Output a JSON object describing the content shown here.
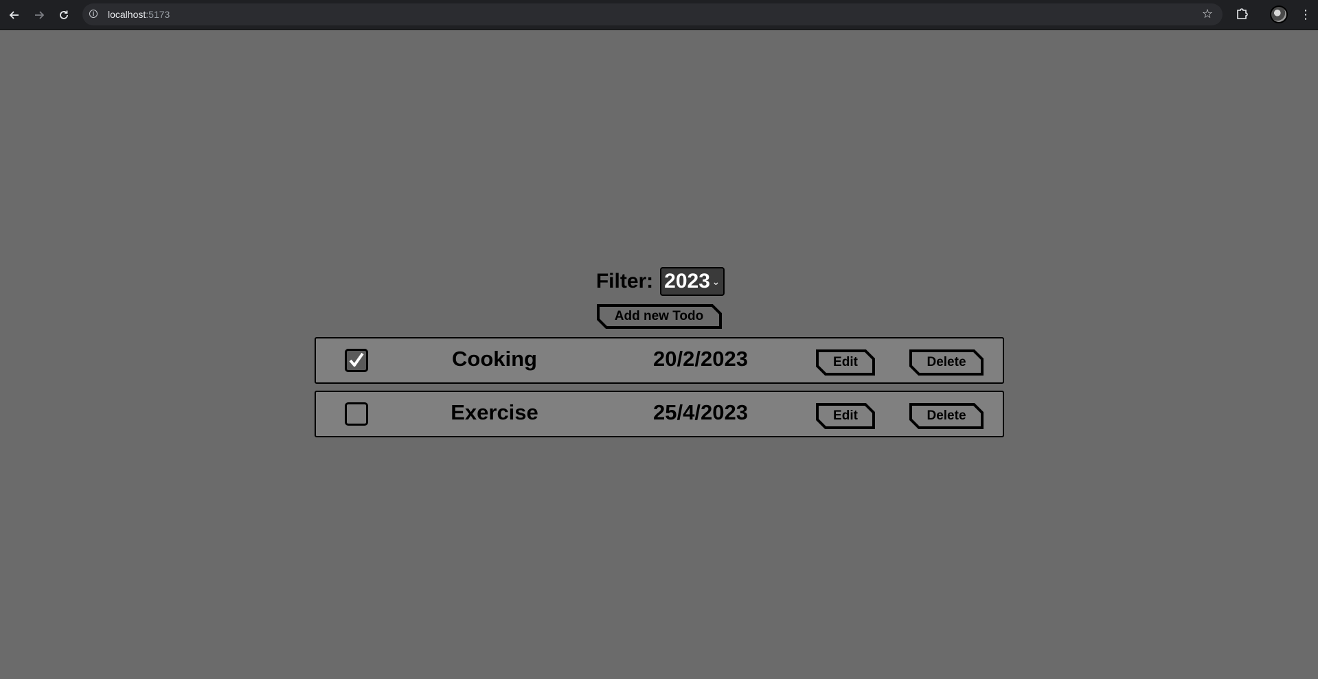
{
  "browser": {
    "url_host": "localhost",
    "url_port": ":5173",
    "back_icon": "arrow-left-icon",
    "forward_icon": "arrow-right-icon",
    "reload_icon": "reload-icon"
  },
  "filter": {
    "label": "Filter:",
    "selected_year": "2023"
  },
  "add_button_label": "Add new Todo",
  "todos": [
    {
      "title": "Cooking",
      "date": "20/2/2023",
      "completed": true,
      "edit_label": "Edit",
      "delete_label": "Delete"
    },
    {
      "title": "Exercise",
      "date": "25/4/2023",
      "completed": false,
      "edit_label": "Edit",
      "delete_label": "Delete"
    }
  ],
  "colors": {
    "page_background": "#6b6b6b",
    "item_background": "#808080",
    "chrome_background": "#1f2023"
  }
}
